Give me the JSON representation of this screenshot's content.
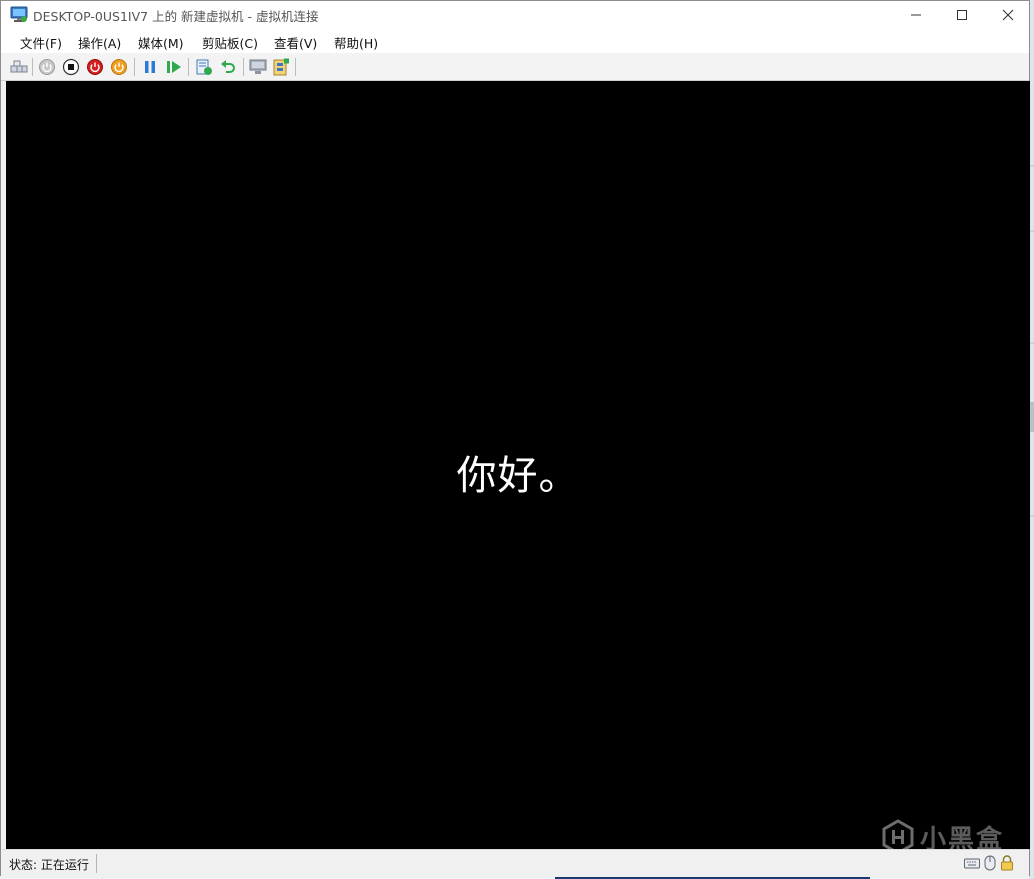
{
  "window": {
    "title": "DESKTOP-0US1IV7 上的 新建虚拟机 - 虚拟机连接"
  },
  "menu": [
    {
      "label": "文件(F)"
    },
    {
      "label": "操作(A)"
    },
    {
      "label": "媒体(M)"
    },
    {
      "label": "剪贴板(C)"
    },
    {
      "label": "查看(V)"
    },
    {
      "label": "帮助(H)"
    }
  ],
  "toolbar": {
    "buttons": [
      "ctrl-alt-del-icon",
      "start-icon",
      "turn-off-icon",
      "shut-down-icon",
      "save-state-icon",
      "pause-icon",
      "resume-icon",
      "checkpoint-icon",
      "revert-icon",
      "enhanced-session-icon",
      "share-icon"
    ]
  },
  "screen": {
    "greeting": "你好。",
    "watermark": "小黑盒"
  },
  "status": {
    "text": "状态: 正在运行"
  },
  "colors": {
    "screen_bg": "#000000",
    "stop_red": "#d21f1f",
    "orange": "#f0a020",
    "blue_pause": "#2a7ad8",
    "green_resume": "#2fa84f"
  }
}
